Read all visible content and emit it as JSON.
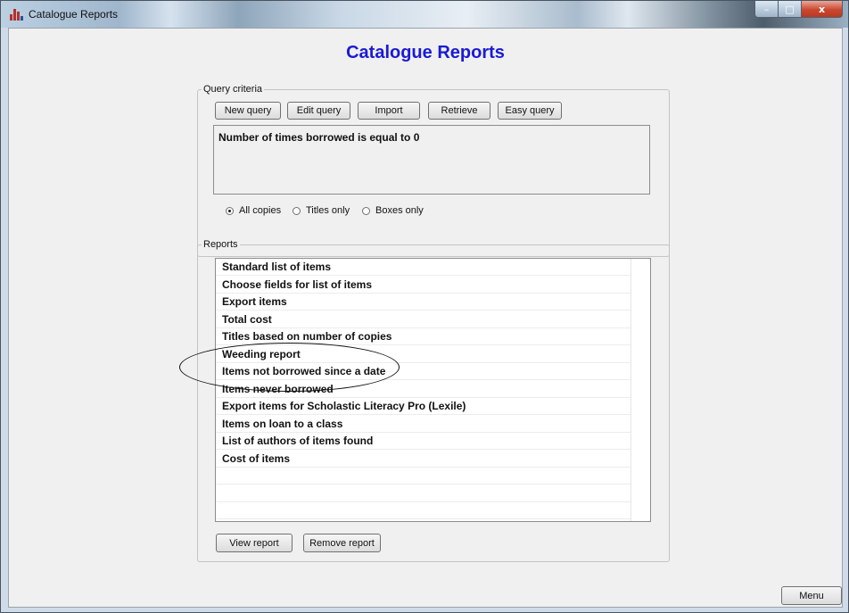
{
  "window": {
    "title": "Catalogue Reports",
    "controls": {
      "minimize": "–",
      "maximize": "□",
      "close": "x"
    }
  },
  "heading": "Catalogue Reports",
  "query_criteria": {
    "legend": "Query criteria",
    "buttons": [
      "New query",
      "Edit query",
      "Import",
      "Retrieve",
      "Easy query"
    ],
    "query_text": "Number of times borrowed is equal to 0",
    "scope_options": [
      {
        "label": "All copies",
        "selected": true
      },
      {
        "label": "Titles only",
        "selected": false
      },
      {
        "label": "Boxes only",
        "selected": false
      }
    ]
  },
  "reports": {
    "legend": "Reports",
    "items": [
      "Standard list of items",
      "Choose fields for list of items",
      "Export items",
      "Total cost",
      "Titles based on number of copies",
      "Weeding report",
      "Items not borrowed since a date",
      "Items never borrowed",
      "Export items for Scholastic Literacy Pro (Lexile)",
      "Items on loan to a class",
      "List of authors of items found",
      "Cost of items"
    ],
    "buttons": {
      "view": "View report",
      "remove": "Remove report"
    }
  },
  "menu_button": "Menu",
  "colors": {
    "heading": "#1a1ad6",
    "background": "#f0f0f0"
  }
}
